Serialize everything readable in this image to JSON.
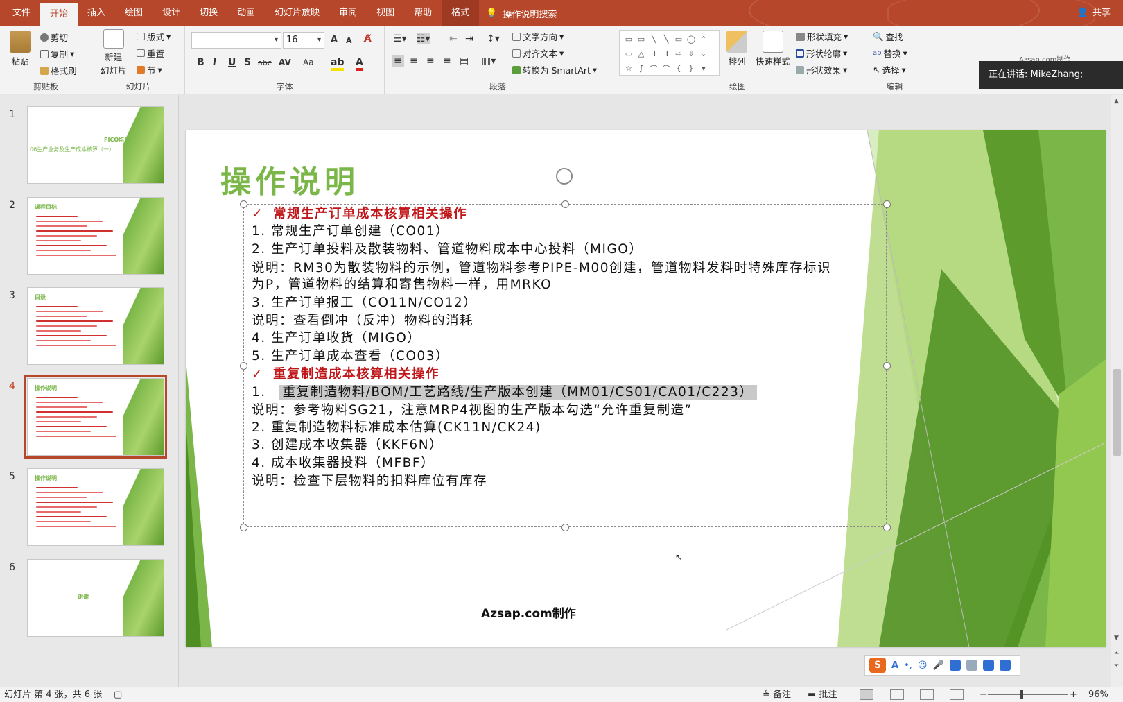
{
  "tabs": [
    "文件",
    "开始",
    "插入",
    "绘图",
    "设计",
    "切换",
    "动画",
    "幻灯片放映",
    "审阅",
    "视图",
    "帮助",
    "格式"
  ],
  "tell_me": "操作说明搜索",
  "share": "共享",
  "ribbon": {
    "clipboard": {
      "paste": "粘贴",
      "cut": "剪切",
      "copy": "复制",
      "format_painter": "格式刷",
      "label": "剪贴板"
    },
    "slides": {
      "new_slide_1": "新建",
      "new_slide_2": "幻灯片",
      "layout": "版式",
      "reset": "重置",
      "section": "节",
      "label": "幻灯片"
    },
    "font": {
      "name": "",
      "size": "16",
      "label": "字体",
      "bold": "B",
      "italic": "I",
      "underline": "U",
      "shadow": "S",
      "strike": "abc",
      "spacing": "AV",
      "case": "Aa",
      "grow": "A",
      "shrink": "A"
    },
    "paragraph": {
      "text_direction": "文字方向",
      "align_text": "对齐文本",
      "smartart": "转换为 SmartArt",
      "label": "段落"
    },
    "drawing": {
      "arrange": "排列",
      "quick_styles": "快速样式",
      "fill": "形状填充",
      "outline": "形状轮廓",
      "effects": "形状效果",
      "label": "绘图"
    },
    "editing": {
      "find": "查找",
      "replace": "替换",
      "select": "选择",
      "label": "编辑"
    }
  },
  "speaking_toast": "正在讲话: MikeZhang;",
  "top_watermark": "Azsap.com制作",
  "thumbnails": [
    {
      "num": "1",
      "title": "FICO培训",
      "subtitle": "06生产业务及生产成本核算（一）"
    },
    {
      "num": "2",
      "title": "课程目标"
    },
    {
      "num": "3",
      "title": "目录"
    },
    {
      "num": "4",
      "title": "操作说明"
    },
    {
      "num": "5",
      "title": "操作说明"
    },
    {
      "num": "6",
      "title": "谢谢"
    }
  ],
  "slide": {
    "title": "操作说明",
    "lines": [
      {
        "text": "常规生产订单成本核算相关操作",
        "style": "red"
      },
      {
        "text": "1.  常规生产订单创建（CO01）"
      },
      {
        "text": "2.  生产订单投料及散装物料、管道物料成本中心投料（MIGO）"
      },
      {
        "text": "说明：RM30为散装物料的示例，管道物料参考PIPE-M00创建，管道物料发料时特殊库存标识"
      },
      {
        "text": "为P，管道物料的结算和寄售物料一样，用MRKO"
      },
      {
        "text": "3. 生产订单报工（CO11N/CO12）"
      },
      {
        "text": "说明：查看倒冲（反冲）物料的消耗"
      },
      {
        "text": "4. 生产订单收货（MIGO）"
      },
      {
        "text": "5. 生产订单成本查看（CO03）"
      },
      {
        "text": "重复制造成本核算相关操作",
        "style": "red"
      },
      {
        "text": "重复制造物料/BOM/工艺路线/生产版本创建（MM01/CS01/CA01/C223）",
        "prefix": "1.",
        "style": "highlight"
      },
      {
        "text": "说明：参考物料SG21，注意MRP4视图的生产版本勾选“允许重复制造”"
      },
      {
        "text": "2. 重复制造物料标准成本估算(CK11N/CK24)"
      },
      {
        "text": "3. 创建成本收集器（KKF6N）"
      },
      {
        "text": "4. 成本收集器投料（MFBF）"
      },
      {
        "text": "说明：检查下层物料的扣料库位有库存"
      }
    ],
    "watermark": "Azsap.com制作"
  },
  "status": {
    "slide_info": "幻灯片 第 4 张，共 6 张",
    "notes": "备注",
    "comments": "批注",
    "zoom": "96%"
  },
  "colors": {
    "accent": "#b7472a",
    "green": "#7ab648",
    "red_text": "#c0171a"
  }
}
